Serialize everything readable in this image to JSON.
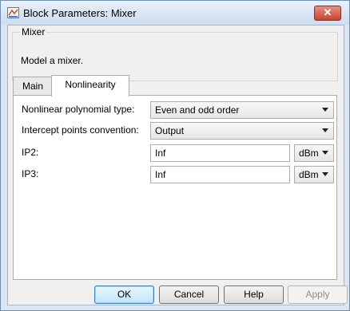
{
  "window": {
    "title": "Block Parameters: Mixer",
    "close_label": "✕"
  },
  "block": {
    "name": "Mixer",
    "description": "Model a mixer."
  },
  "tabs": [
    {
      "label": "Main",
      "active": false
    },
    {
      "label": "Nonlinearity",
      "active": true
    }
  ],
  "params": {
    "nonlinear_type": {
      "label": "Nonlinear polynomial type:",
      "value": "Even and odd order"
    },
    "intercept_convention": {
      "label": "Intercept points convention:",
      "value": "Output"
    },
    "ip2": {
      "label": "IP2:",
      "value": "Inf",
      "unit": "dBm"
    },
    "ip3": {
      "label": "IP3:",
      "value": "Inf",
      "unit": "dBm"
    }
  },
  "buttons": {
    "ok": "OK",
    "cancel": "Cancel",
    "help": "Help",
    "apply": "Apply"
  },
  "icons": {
    "app": "simulink-block-icon",
    "close": "close-icon",
    "dropdown": "chevron-down-icon"
  },
  "colors": {
    "close_button": "#c9442f",
    "title_bar": "#dce6f2",
    "default_button": "#3c7fb1"
  }
}
